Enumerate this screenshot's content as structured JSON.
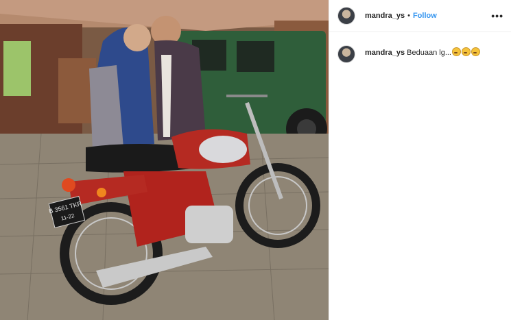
{
  "post": {
    "username": "mandra_ys",
    "separator": "•",
    "follow_label": "Follow",
    "more_icon": "•••",
    "caption": {
      "username": "mandra_ys",
      "text": "Beduaan lg...",
      "emoji": [
        "grimacing-face",
        "grimacing-face",
        "grimacing-face"
      ]
    }
  },
  "photo": {
    "plate_line1": "B 3561 TKR",
    "plate_line2": "11-22"
  }
}
